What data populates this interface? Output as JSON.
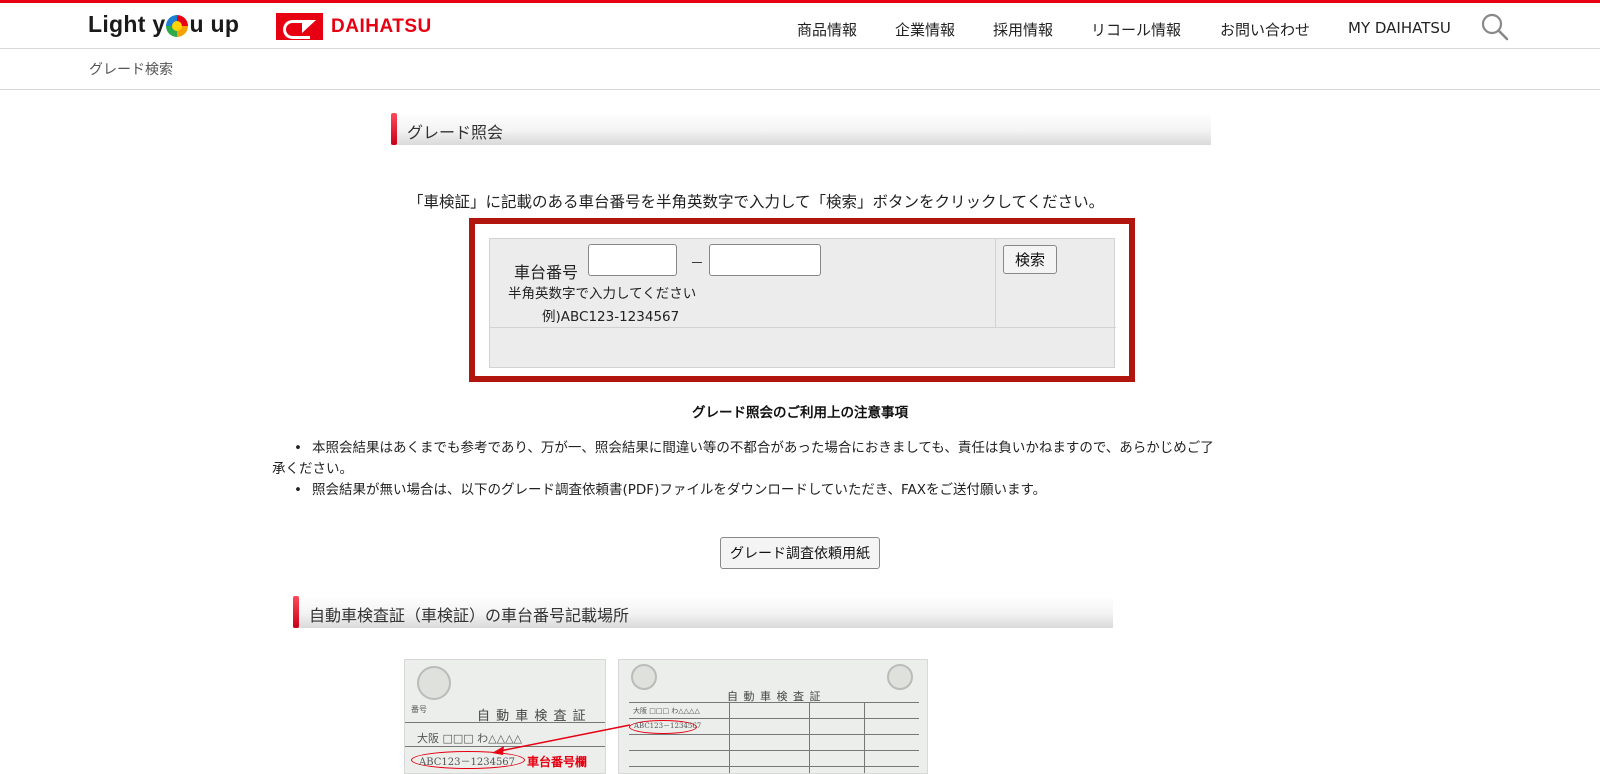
{
  "header": {
    "logo_text_before": "Light y",
    "logo_text_after": "u up",
    "brand_name": "DAIHATSU",
    "nav": [
      "商品情報",
      "企業情報",
      "採用情報",
      "リコール情報",
      "お問い合わせ",
      "MY DAIHATSU"
    ],
    "search_icon": "search-icon"
  },
  "breadcrumb": "グレード検索",
  "section1": {
    "title": "グレード照会"
  },
  "instruction": "「車検証」に記載のある車台番号を半角英数字で入力して「検索」ボタンをクリックしてください。",
  "form": {
    "label": "車台番号",
    "input1_value": "",
    "input2_value": "",
    "separator": "－",
    "hint": "半角英数字で入力してください",
    "example": "例)ABC123-1234567",
    "search_button": "検索"
  },
  "notes": {
    "title": "グレード照会のご利用上の注意事項",
    "items": [
      "本照会結果はあくまでも参考であり、万が一、照会結果に間違い等の不都合があった場合におきましても、責任は負いかねますので、あらかじめご了",
      "承ください。",
      "照会結果が無い場合は、以下のグレード調査依頼書(PDF)ファイルをダウンロードしていただき、FAXをご送付願います。"
    ]
  },
  "pdf_button": "グレード調査依頼用紙",
  "section2": {
    "title": "自動車検査証（車検証）の車台番号記載場所"
  },
  "certificate": {
    "title": "自 動 車 検 査 証",
    "number_label": "番号",
    "plate": "大阪 □□□ わ△△△△",
    "vin": "ABC123－1234567",
    "callout": "車台番号欄"
  },
  "colors": {
    "accent": "#e60012",
    "frame": "#b0160e"
  }
}
